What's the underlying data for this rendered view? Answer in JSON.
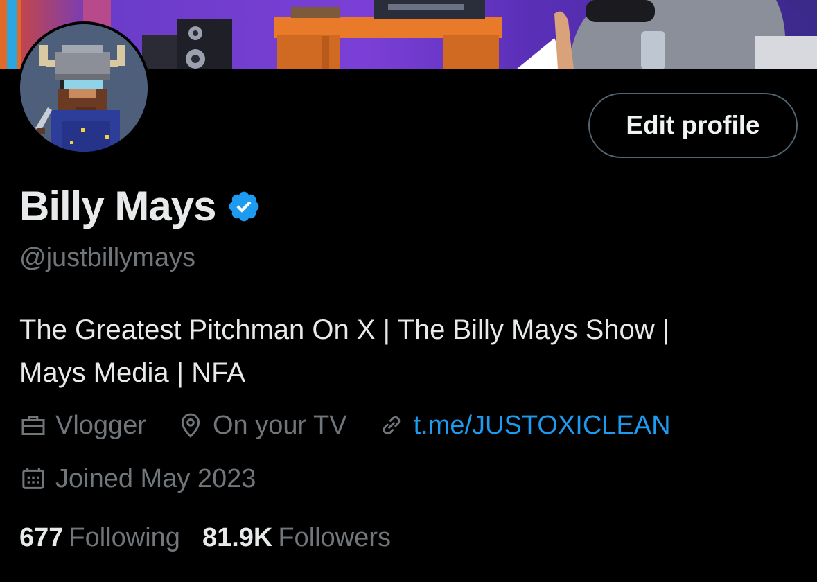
{
  "profile": {
    "name": "Billy Mays",
    "handle": "@justbillymays",
    "bio_line1": "The Greatest Pitchman On X | The Billy Mays Show |",
    "bio_line2": "Mays Media | NFA",
    "edit_label": "Edit profile",
    "occupation": "Vlogger",
    "location": "On your TV",
    "link_text": "t.me/JUSTOXICLEAN",
    "joined": "Joined May 2023",
    "following_count": "677",
    "following_label": "Following",
    "followers_count": "81.9K",
    "followers_label": "Followers"
  },
  "icons": {
    "occupation": "briefcase-icon",
    "location": "map-pin-icon",
    "link": "link-icon",
    "joined": "calendar-icon",
    "verified": "verified-badge-icon"
  },
  "colors": {
    "background": "#000000",
    "text": "#e7e9ea",
    "secondary_text": "#71767b",
    "link": "#1d9bf0",
    "verified": "#1d9bf0"
  }
}
